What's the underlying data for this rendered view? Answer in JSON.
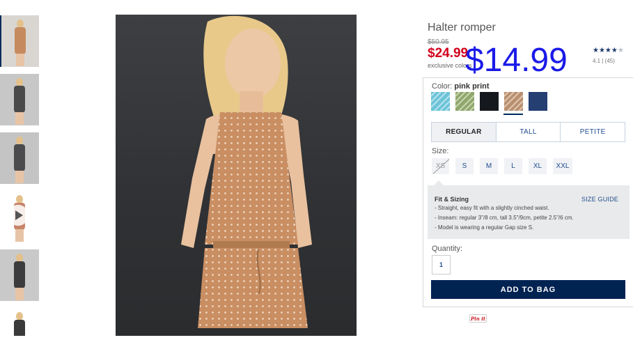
{
  "thumbnails": [
    {
      "id": "front",
      "bg": "#d9d6d2",
      "dress": "#c58a5e",
      "selected": true
    },
    {
      "id": "back",
      "bg": "#c7c7c7",
      "dress": "#4a4a4a",
      "selected": false
    },
    {
      "id": "side",
      "bg": "#c4c4c4",
      "dress": "#4b4b4d",
      "selected": false
    },
    {
      "id": "video",
      "bg": "#ffffff",
      "dress": "#c7856a",
      "selected": false
    },
    {
      "id": "dark",
      "bg": "#c9c9c9",
      "dress": "#3c3c3e",
      "selected": false
    },
    {
      "id": "detail",
      "bg": "#ffffff",
      "dress": "#3a3a3a",
      "selected": false
    }
  ],
  "product": {
    "title": "Halter romper",
    "old_price": "$50.95",
    "sale_price": "$24.99",
    "exclusive_text": "exclusive colors",
    "promo_price": "$14.99",
    "rating_value": 4.1,
    "stars": "★★★★",
    "star_empty": "★",
    "rating_text": "4.1  |  (45)"
  },
  "color": {
    "label": "Color:",
    "selected_name": "pink print",
    "swatches": [
      {
        "name": "light blue print",
        "color": "#6dc3d8",
        "pattern": "#b8e4ee"
      },
      {
        "name": "green print",
        "color": "#8fa66d",
        "pattern": "#c9d6b0"
      },
      {
        "name": "black",
        "color": "#15181d",
        "pattern": "#15181d"
      },
      {
        "name": "pink print",
        "color": "#b98f6f",
        "pattern": "#e0c6b0"
      },
      {
        "name": "navy",
        "color": "#253f73",
        "pattern": "#253f73"
      }
    ]
  },
  "fit_tabs": [
    "REGULAR",
    "TALL",
    "PETITE"
  ],
  "size": {
    "label": "Size:",
    "options": [
      {
        "label": "XS",
        "available": false
      },
      {
        "label": "S",
        "available": true
      },
      {
        "label": "M",
        "available": true
      },
      {
        "label": "L",
        "available": true
      },
      {
        "label": "XL",
        "available": true
      },
      {
        "label": "XXL",
        "available": true
      }
    ]
  },
  "fit_sizing": {
    "title": "Fit & Sizing",
    "size_guide": "SIZE GUIDE",
    "lines": [
      "- Straight, easy fit with a slightly cinched waist.",
      "- Inseam: regular 3\"/8 cm, tall 3.5\"/9cm, petite 2.5\"/6 cm.",
      "- Model is wearing a regular Gap size S."
    ]
  },
  "quantity": {
    "label": "Quantity:",
    "value": "1"
  },
  "add_to_bag": "ADD TO BAG",
  "pin_it": "Pin it",
  "colors": {
    "navy": "#002352",
    "sale_red": "#d0021b",
    "link_blue": "#1f4c8f",
    "promo_blue": "#1a1ae8"
  }
}
